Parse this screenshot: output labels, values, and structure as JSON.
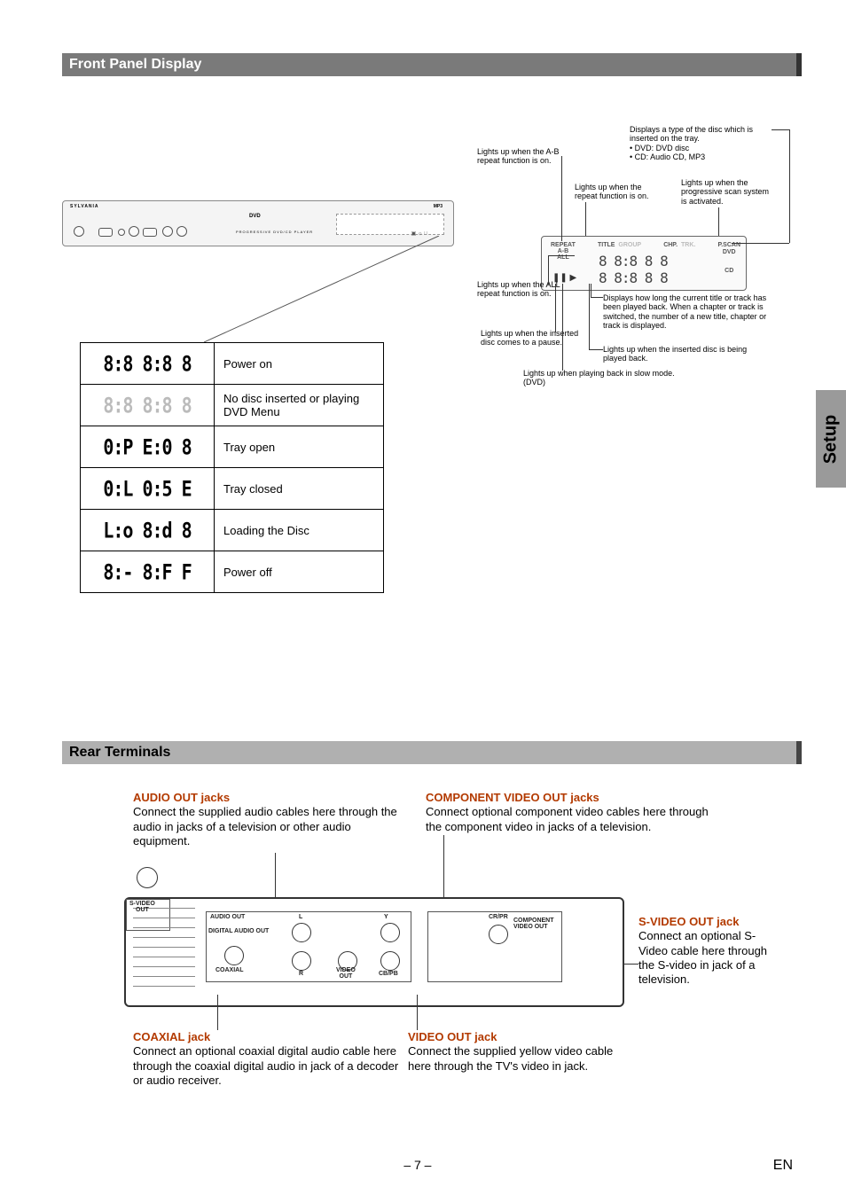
{
  "section1_title": "Front Panel Display",
  "section2_title": "Rear Terminals",
  "side_tab": "Setup",
  "device": {
    "brand": "SYLVANIA",
    "logo": "DVD",
    "sublogo": "PROGRESSIVE DVD/CD PLAYER",
    "mp3_label": "MP3"
  },
  "display_indicators": {
    "ab_repeat": "Lights up when the A-B repeat function is on.",
    "disc_type": "Displays a type of the disc which is inserted on the tray.\n• DVD: DVD disc\n• CD: Audio CD, MP3",
    "repeat_on": "Lights up when the repeat function is on.",
    "pscan": "Lights up when the progressive scan system is activated.",
    "all_repeat": "Lights up when the ALL repeat function is on.",
    "pause": "Lights up when the inserted disc comes to a pause.",
    "slow": "Lights up when playing back in slow mode. (DVD)",
    "elapsed": "Displays how long the current title or track has been played back. When a chapter or track is switched, the number of a new title, chapter or track is displayed.",
    "playing": "Lights up when the inserted disc is being played back."
  },
  "display_box": {
    "repeat": "REPEAT",
    "ab": "A-B",
    "all": "ALL",
    "title": "TITLE",
    "group": "GROUP",
    "chp": "CHP.",
    "trk": "TRK.",
    "pscan": "P.SCAN",
    "dvd": "DVD",
    "cd": "CD",
    "pause_icon": "❚❚ ▶",
    "digits": "8 8:8 8 8\n8 8:8 8 8"
  },
  "status_rows": [
    {
      "segments": "8:8 8:8 8",
      "dim": false,
      "label": "Power on"
    },
    {
      "segments": "8:8 8:8 8",
      "dim": true,
      "label": "No disc inserted or playing DVD Menu"
    },
    {
      "segments": "0:P E:0 8",
      "dim": false,
      "label": "Tray open"
    },
    {
      "segments": "0:L 0:5 E",
      "dim": false,
      "label": "Tray closed"
    },
    {
      "segments": "L:o 8:d 8",
      "dim": false,
      "label": "Loading the Disc"
    },
    {
      "segments": "8:- 8:F F",
      "dim": false,
      "label": "Power off"
    }
  ],
  "rear": {
    "audio_out": {
      "title": "AUDIO OUT jacks",
      "body": "Connect the supplied audio cables here through the audio in jacks of a television or other audio equipment."
    },
    "component": {
      "title": "COMPONENT VIDEO OUT jacks",
      "body": "Connect optional component video cables here through the component video in jacks of a television."
    },
    "coaxial": {
      "title": "COAXIAL jack",
      "body": "Connect an optional coaxial digital audio cable here through the coaxial digital audio in jack of a decoder or audio receiver."
    },
    "video_out": {
      "title": "VIDEO OUT jack",
      "body": "Connect the supplied yellow video cable here through the TV's video in jack."
    },
    "svideo": {
      "title": "S-VIDEO OUT jack",
      "body": "Connect an optional S-Video cable here through the S-video in jack of a television."
    },
    "labels": {
      "audio_out": "AUDIO OUT",
      "digital_audio_out": "DIGITAL AUDIO OUT",
      "coaxial": "COAXIAL",
      "l": "L",
      "r": "R",
      "y": "Y",
      "crpr": "CR/PR",
      "cbpb": "CB/PB",
      "component_video_out": "COMPONENT\nVIDEO OUT",
      "video_out": "VIDEO\nOUT",
      "s_video_out": "S-VIDEO\nOUT"
    }
  },
  "footer": {
    "page": "– 7 –",
    "lang": "EN"
  }
}
